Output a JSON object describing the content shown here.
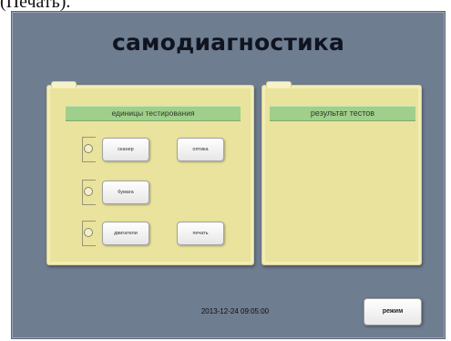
{
  "caption": "(Печать).",
  "title": "самодиагностика",
  "units_panel": {
    "header": "единицы тестирования",
    "buttons": [
      {
        "label": "сканер"
      },
      {
        "label": "оптика"
      },
      {
        "label": "бумага"
      },
      {
        "label": "двигатели"
      },
      {
        "label": "печать"
      }
    ]
  },
  "results_panel": {
    "header": "результат тестов"
  },
  "status": {
    "datetime": "2013-12-24  09:05:00"
  },
  "mode_button": {
    "label": "режим"
  }
}
